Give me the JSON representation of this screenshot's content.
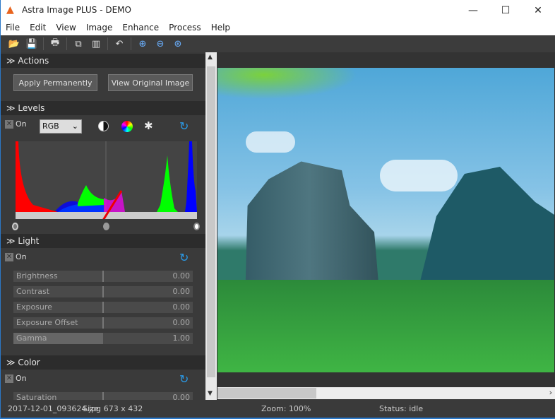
{
  "window": {
    "title": "Astra Image PLUS - DEMO",
    "minimize": "—",
    "maximize": "☐",
    "close": "✕"
  },
  "menu": [
    "File",
    "Edit",
    "View",
    "Image",
    "Enhance",
    "Process",
    "Help"
  ],
  "toolbar": [
    {
      "icon": "open-folder-icon",
      "glyph": "📂"
    },
    {
      "icon": "save-icon",
      "glyph": "💾"
    },
    {
      "icon": "print-icon",
      "glyph": "🖶"
    },
    {
      "icon": "copy-icon",
      "glyph": "⧉"
    },
    {
      "icon": "compare-icon",
      "glyph": "▥"
    },
    {
      "icon": "undo-icon",
      "glyph": "↶"
    },
    {
      "icon": "zoom-in-icon",
      "glyph": "⊕"
    },
    {
      "icon": "zoom-out-icon",
      "glyph": "⊖"
    },
    {
      "icon": "zoom-fit-icon",
      "glyph": "⊛"
    }
  ],
  "actions": {
    "title": "Actions",
    "apply": "Apply Permanently",
    "view_original": "View Original Image"
  },
  "levels": {
    "title": "Levels",
    "on": "On",
    "channel": "RGB"
  },
  "light": {
    "title": "Light",
    "on": "On",
    "sliders": [
      {
        "label": "Brightness",
        "value": "0.00"
      },
      {
        "label": "Contrast",
        "value": "0.00"
      },
      {
        "label": "Exposure",
        "value": "0.00"
      },
      {
        "label": "Exposure Offset",
        "value": "0.00"
      },
      {
        "label": "Gamma",
        "value": "1.00"
      }
    ]
  },
  "color": {
    "title": "Color",
    "on": "On",
    "sliders": [
      {
        "label": "Saturation",
        "value": "0.00"
      }
    ]
  },
  "status": {
    "file": "2017-12-01_093624.jpg",
    "size": "Size: 673 x 432",
    "zoom": "Zoom: 100%",
    "status": "Status: idle"
  },
  "colors": {
    "accent": "#2a9be8",
    "panel": "#3a3a3a"
  }
}
